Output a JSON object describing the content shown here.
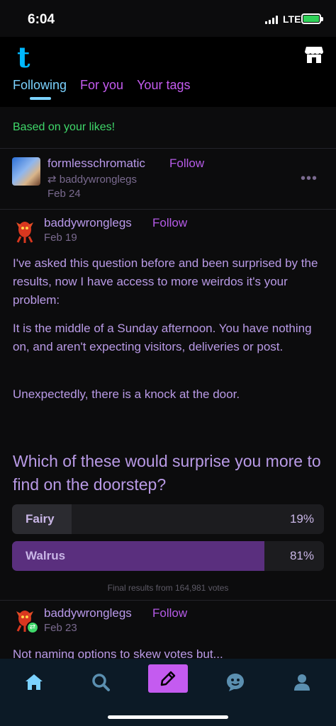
{
  "status": {
    "time": "6:04",
    "network": "LTE"
  },
  "header": {
    "logo": "t",
    "tabs": [
      {
        "label": "Following",
        "active": true
      },
      {
        "label": "For you",
        "active": false
      },
      {
        "label": "Your tags",
        "active": false
      }
    ]
  },
  "feed": {
    "based_on": "Based on your likes!",
    "reblog": {
      "user": "formlesschromatic",
      "follow": "Follow",
      "reblogged_from": "baddywronglegs",
      "date": "Feb 24",
      "more": "•••"
    },
    "post": {
      "user": "baddywronglegs",
      "follow": "Follow",
      "date": "Feb 19",
      "paragraphs": [
        "I've asked this question before and been surprised by the results, now I have access to more weirdos it's your problem:",
        "It is the middle of a Sunday afternoon. You have nothing on, and aren't expecting visitors, deliveries or post.",
        "Unexpectedly, there is a knock at the door."
      ],
      "poll": {
        "question": "Which of these would surprise you more to find on the doorstep?",
        "options": [
          {
            "label": "Fairy",
            "percent_text": "19%",
            "percent": 19
          },
          {
            "label": "Walrus",
            "percent_text": "81%",
            "percent": 81
          }
        ],
        "footer": "Final results from 164,981 votes"
      }
    },
    "next_post": {
      "user": "baddywronglegs",
      "follow": "Follow",
      "date": "Feb 23",
      "text": "Not naming options to skew votes but..."
    }
  },
  "colors": {
    "accent_purple": "#c45bf0",
    "following_blue": "#7bd2ff",
    "green": "#3fd86a",
    "poll_winner": "#5a2f7e",
    "poll_loser": "#2b2b30"
  },
  "nav": [
    "home-icon",
    "search-icon",
    "compose-icon",
    "activity-icon",
    "account-icon"
  ]
}
